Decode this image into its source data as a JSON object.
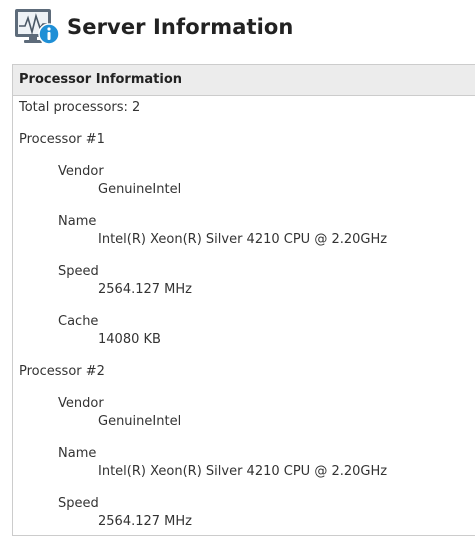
{
  "page": {
    "title": "Server Information"
  },
  "panel": {
    "header": "Processor Information",
    "total": "Total processors: 2",
    "processors": [
      {
        "title": "Processor #1",
        "fields": [
          {
            "label": "Vendor",
            "value": "GenuineIntel"
          },
          {
            "label": "Name",
            "value": "Intel(R) Xeon(R) Silver 4210 CPU @ 2.20GHz"
          },
          {
            "label": "Speed",
            "value": "2564.127 MHz"
          },
          {
            "label": "Cache",
            "value": "14080 KB"
          }
        ]
      },
      {
        "title": "Processor #2",
        "fields": [
          {
            "label": "Vendor",
            "value": "GenuineIntel"
          },
          {
            "label": "Name",
            "value": "Intel(R) Xeon(R) Silver 4210 CPU @ 2.20GHz"
          },
          {
            "label": "Speed",
            "value": "2564.127 MHz"
          }
        ]
      }
    ]
  },
  "colors": {
    "accent": "#1f8fd6",
    "icon_frame": "#5d6b7a",
    "header_bg": "#ececec",
    "border": "#cccccc"
  }
}
